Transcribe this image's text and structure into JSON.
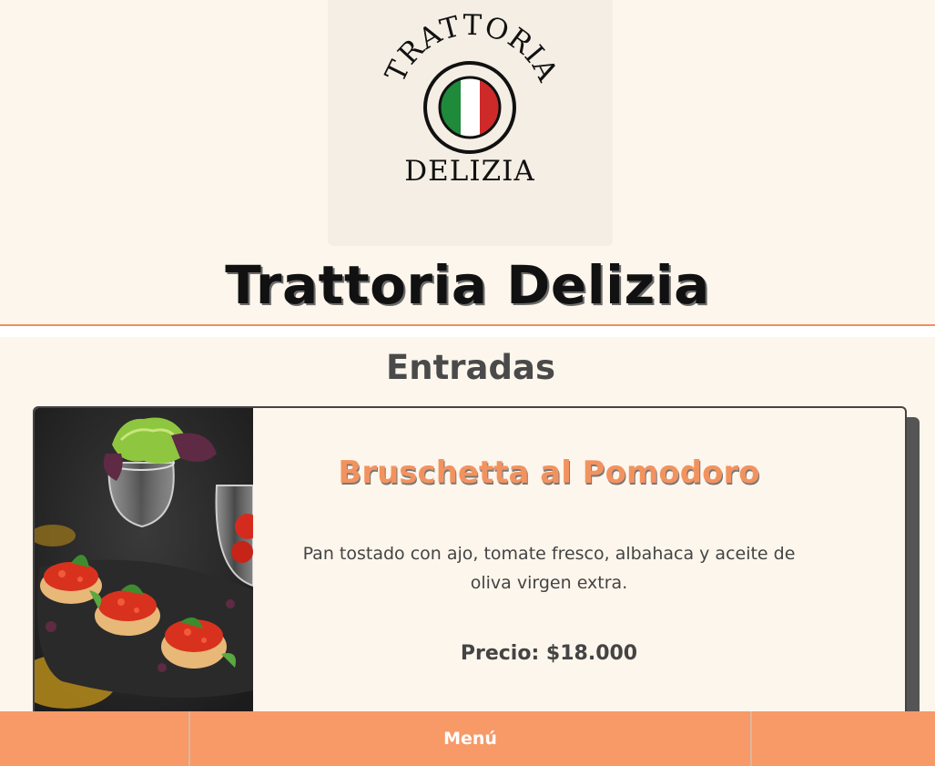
{
  "logo": {
    "top_text": "TRATTORIA",
    "bottom_text": "DELIZIA",
    "flag_colors": [
      "#1e8a3a",
      "#ffffff",
      "#cf2a2a"
    ]
  },
  "header": {
    "title": "Trattoria Delizia"
  },
  "section": {
    "title": "Entradas"
  },
  "dish": {
    "name": "Bruschetta al Pomodoro",
    "description": "Pan tostado con ajo, tomate fresco, albahaca y aceite de oliva virgen extra.",
    "price": "Precio: $18.000"
  },
  "bottom_nav": {
    "menu_label": "Menú"
  },
  "colors": {
    "background": "#fdf6ec",
    "accent": "#f79a68",
    "dish_title": "#f2935f",
    "text_dark": "#444444"
  }
}
